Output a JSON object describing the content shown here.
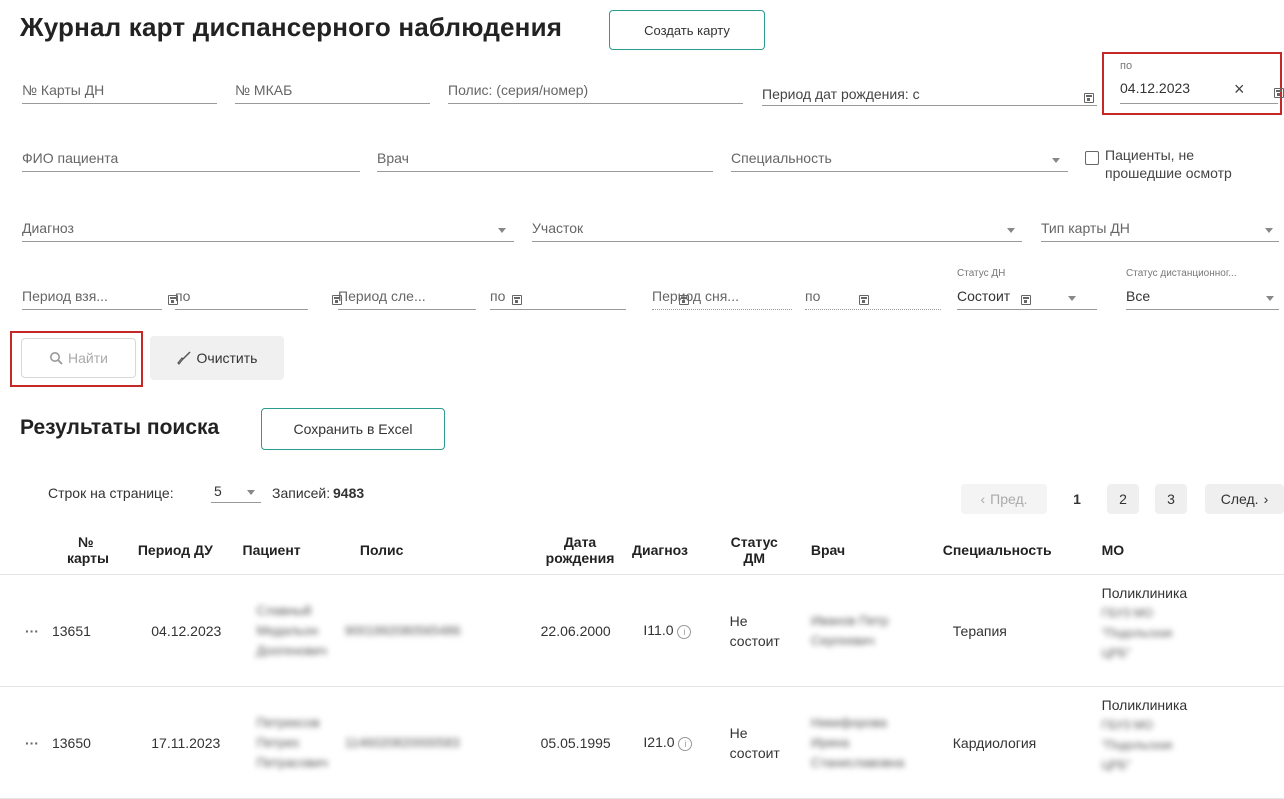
{
  "header": {
    "title": "Журнал карт диспансерного наблюдения",
    "create_button": "Создать карту"
  },
  "filters": {
    "card_no": "№ Карты ДН",
    "mkab": "№ МКАБ",
    "policy": "Полис: (серия/номер)",
    "birth_period_label": "Период дат рождения: с",
    "birth_to_label": "по",
    "birth_to_value": "04.12.2023",
    "clear_x": "×",
    "patient_name": "ФИО пациента",
    "doctor": "Врач",
    "specialty": "Специальность",
    "not_examined_line1": "Пациенты, не",
    "not_examined_line2": "прошедшие осмотр",
    "diagnosis": "Диагноз",
    "district": "Участок",
    "card_type": "Тип карты ДН",
    "taken_period": "Период взя...",
    "next_period": "Период сле...",
    "removed_period": "Период сня...",
    "to_label": "по",
    "status_dn_label": "Статус ДН",
    "status_dn_value": "Состоит",
    "remote_status_label": "Статус дистанционног...",
    "remote_status_value": "Все"
  },
  "actions": {
    "find": "Найти",
    "clear": "Очистить"
  },
  "results": {
    "title": "Результаты поиска",
    "excel_button": "Сохранить в Excel",
    "rows_per_page_label": "Строк на странице:",
    "rows_per_page_value": "5",
    "records_label": "Записей:",
    "records_count": "9483"
  },
  "pagination": {
    "prev": "Пред.",
    "pages": [
      "1",
      "2",
      "3"
    ],
    "next": "След."
  },
  "table": {
    "headers": {
      "card_no": [
        "№",
        "карты"
      ],
      "period": "Период ДУ",
      "patient": "Пациент",
      "policy": "Полис",
      "birth": [
        "Дата",
        "рождения"
      ],
      "diagnosis": "Диагноз",
      "status": [
        "Статус",
        "ДМ"
      ],
      "doctor": "Врач",
      "specialty": "Специальность",
      "mo": "МО"
    },
    "rows": [
      {
        "menu": "···",
        "card_no": "13651",
        "period": "04.12.2023",
        "patient": [
          "Славный",
          "Медальон",
          "Доогенович"
        ],
        "policy": "9001992080565486",
        "birth": "22.06.2000",
        "diagnosis": "I11.0",
        "status": [
          "Не",
          "состоит"
        ],
        "doctor": [
          "Иванов Петр",
          "Сергеевич"
        ],
        "specialty": "Терапия",
        "mo": [
          "Поликлиника",
          "ГБУЗ МО",
          "\"Подольская",
          "ЦРБ\""
        ]
      },
      {
        "menu": "···",
        "card_no": "13650",
        "period": "17.11.2023",
        "patient": [
          "Петрексов",
          "Петрех",
          "Петрасович"
        ],
        "policy": "1146020820000583",
        "birth": "05.05.1995",
        "diagnosis": "I21.0",
        "status": [
          "Не",
          "состоит"
        ],
        "doctor": [
          "Никифорова",
          "Ирина",
          "Станиславовна"
        ],
        "specialty": "Кардиология",
        "mo": [
          "Поликлиника",
          "ГБУЗ МО",
          "\"Подольская",
          "ЦРБ\""
        ]
      }
    ]
  },
  "colors": {
    "accent": "#2b9a8f",
    "highlight": "#c62828"
  }
}
